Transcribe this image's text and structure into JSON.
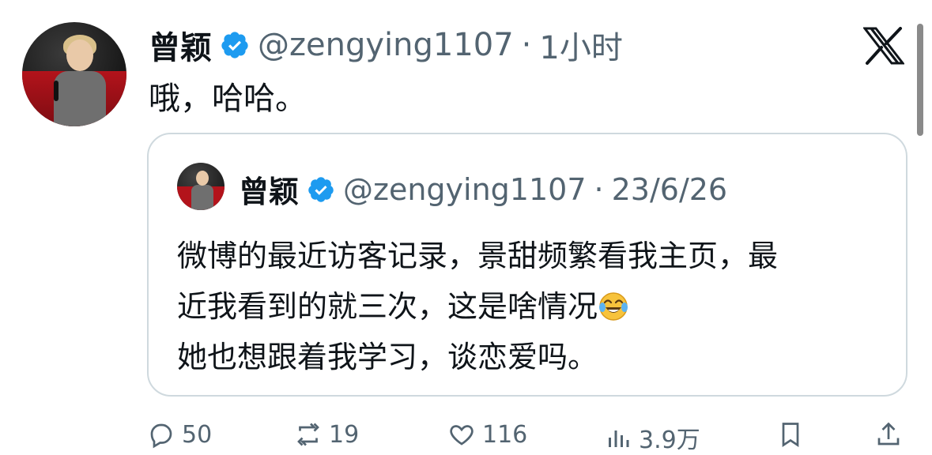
{
  "tweet": {
    "author_name": "曾颖",
    "handle": "@zengying1107",
    "separator": "·",
    "time": "1小时",
    "text": "哦，哈哈。"
  },
  "quoted": {
    "author_name": "曾颖",
    "handle": "@zengying1107",
    "separator": "·",
    "date": "23/6/26",
    "lines": [
      "微博的最近访客记录，景甜频繁看我主页，最",
      "近我看到的就三次，这是啥情况",
      "她也想跟着我学习，谈恋爱吗。"
    ],
    "emoji": "face-with-tears-of-joy"
  },
  "actions": {
    "replies": "50",
    "reposts": "19",
    "likes": "116",
    "views": "3.9万"
  },
  "colors": {
    "verified": "#1d9bf0",
    "secondary_text": "#536471",
    "border": "#cfd9de"
  },
  "icons": {
    "x_logo": "x-logo-icon",
    "verified": "verified-badge-icon",
    "reply": "reply-icon",
    "repost": "repost-icon",
    "like": "heart-icon",
    "views": "views-icon",
    "bookmark": "bookmark-icon",
    "share": "share-icon"
  }
}
